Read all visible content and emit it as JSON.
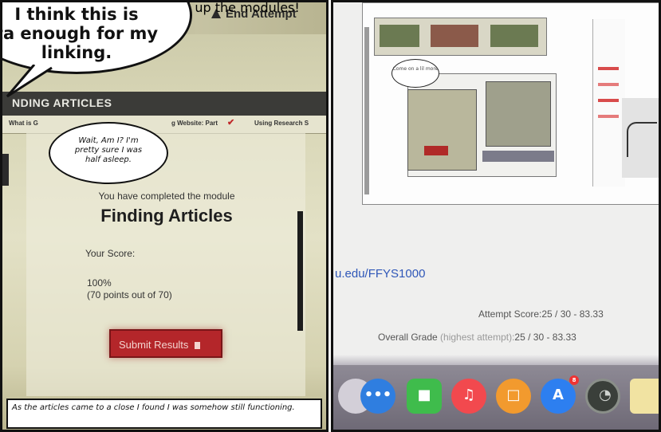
{
  "left_panel": {
    "speech_bubble_top": {
      "line1": "I think this is",
      "line2": "ta enough for my",
      "line3": "linking."
    },
    "end_attempt_label": "End Attempt",
    "module_header": "NDING ARTICLES",
    "subnav": {
      "item1": "What is G",
      "item2": "g Website: Part",
      "item3": "Using Research S"
    },
    "thought_bubble": {
      "line1": "Wait, Am I? I'm",
      "line2": "pretty sure I was",
      "line3": "half asleep."
    },
    "completed_text": "You have completed the module",
    "module_title": "Finding Articles",
    "score_label": "Your Score:",
    "score_percent": "100%",
    "score_points": "(70 points out of 70)",
    "submit_button_label": "Submit Results",
    "note_box": "With one final push I wrapped up the modules!",
    "caption": "As the articles came to a close I found I was somehow still functioning."
  },
  "right_panel": {
    "mini_bubble_text": "Come on a lil more",
    "link_text": "u.edu/FFYS1000",
    "attempt_score": "Attempt Score:25 / 30 - 83.33",
    "overall_grade_label": "Overall Grade",
    "overall_grade_muted": "(highest attempt):",
    "overall_grade_value": "25 / 30 - 83.33",
    "dock_badge_count": "8",
    "dock_icons": [
      "messages-icon",
      "facetime-icon",
      "music-icon",
      "books-icon",
      "app-store-icon",
      "time-machine-icon",
      "notes-icon"
    ],
    "colors": {
      "link": "#2f57b8",
      "submit_button": "#b4262a",
      "dock": "#7a7582"
    }
  }
}
